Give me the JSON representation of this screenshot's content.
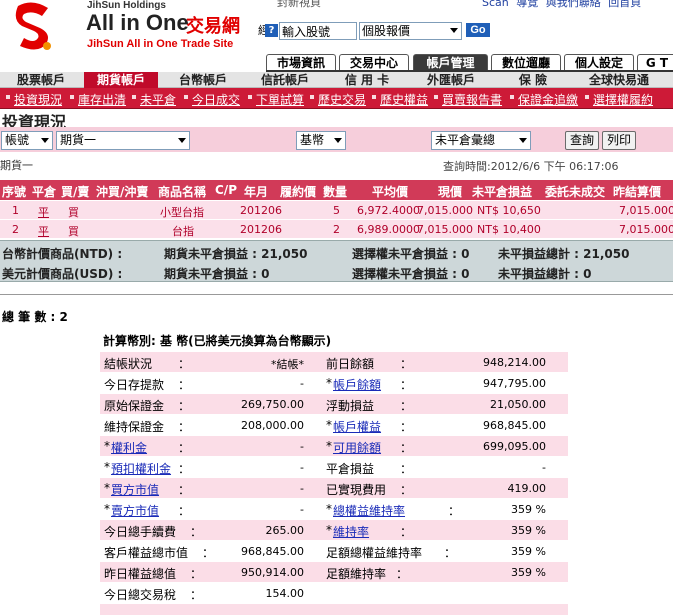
{
  "brand": {
    "holdings": "JihSun Holdings",
    "name": "All in One",
    "name_cn": "交易網",
    "subtitle": "JihSun All in One Trade Site"
  },
  "top_links": [
    "Scan",
    "導覽",
    "與我們聯絡",
    "回首頁"
  ],
  "top_strip_text": "封新視頁",
  "quote": {
    "help_icon": "?",
    "input_value": "輸入股號",
    "select_value": "個股報價",
    "go_label": "Go",
    "label_fragment": "經"
  },
  "main_tabs": [
    "市場資訊",
    "交易中心",
    "帳戶管理",
    "數位遛廳",
    "個人設定",
    "G T"
  ],
  "main_tab_active": 2,
  "account_menu": [
    "股票帳戶",
    "期貨帳戶",
    "台幣帳戶",
    "信託帳戶",
    "信 用 卡",
    "外匯帳戶",
    "保    險",
    "全球快易通"
  ],
  "account_active": 1,
  "sub_menu": [
    "投資現況",
    "庫存出清",
    "未平倉",
    "今日成交",
    "下單試算",
    "歷史交易",
    "歷史權益",
    "買賣報告書",
    "保證金追繳",
    "選擇權履約"
  ],
  "page_title": "投資現況",
  "filters": {
    "account_type": "帳號",
    "account": "期貨一",
    "currency": "基幣",
    "report": "未平倉彙總",
    "query_button": "查詢",
    "print_button": "列印"
  },
  "account_label": "期貨一",
  "query_time": "查詢時間:2012/6/6 下午 06:17:06",
  "positions": {
    "headers": [
      "序號",
      "平倉",
      "買/賣",
      "沖買/沖賣",
      "商品名稱",
      "C/P",
      "年月",
      "履約價",
      "數量",
      "平均價",
      "現價",
      "未平倉損益",
      "委託未成交",
      "昨結算價"
    ],
    "rows": [
      {
        "no": "1",
        "close": "平",
        "side": "買",
        "offset": "",
        "product": "小型台指",
        "cp": "",
        "ym": "201206",
        "strike": "",
        "qty": "5",
        "avg": "6,972.4000",
        "last": "7,015.000",
        "pnl": "NT$ 10,650",
        "pending": "",
        "settle": "7,015.000"
      },
      {
        "no": "2",
        "close": "平",
        "side": "買",
        "offset": "",
        "product": "台指",
        "cp": "",
        "ym": "201206",
        "strike": "",
        "qty": "2",
        "avg": "6,989.0000",
        "last": "7,015.000",
        "pnl": "NT$ 10,400",
        "pending": "",
        "settle": "7,015.000"
      }
    ]
  },
  "summary": {
    "ntd_label": "台幣計價商品(NTD) :",
    "usd_label": "美元計價商品(USD) :",
    "ntd_futures": "期貨未平倉損益 : 21,050",
    "ntd_options": "選擇權未平倉損益 : 0",
    "ntd_total": "未平損益總計 : 21,050",
    "usd_futures": "期貨未平倉損益 : 0",
    "usd_options": "選擇權未平倉損益 : 0",
    "usd_total": "未平損益總計 : 0"
  },
  "total_count": "總 筆 數 : 2",
  "calc_title": "計算幣別: 基 幣(已將美元換算為台幣顯示)",
  "detail": [
    {
      "l1": "結帳狀況",
      "v1": "*結帳*",
      "l2": "前日餘額",
      "v2": "948,214.00"
    },
    {
      "l1": "今日存提款",
      "v1": "-",
      "l2": "帳戶餘額",
      "v2": "947,795.00"
    },
    {
      "l1": "原始保證金",
      "v1": "269,750.00",
      "l2": "浮動損益",
      "v2": "21,050.00"
    },
    {
      "l1": "維持保證金",
      "v1": "208,000.00",
      "l2": "帳戶權益",
      "v2": "968,845.00"
    },
    {
      "l1": "權利金",
      "v1": "-",
      "l2": "可用餘額",
      "v2": "699,095.00"
    },
    {
      "l1": "預扣權利金",
      "v1": "-",
      "l2": "平倉損益",
      "v2": "-"
    },
    {
      "l1": "買方市值",
      "v1": "-",
      "l2": "已實現費用",
      "v2": "419.00"
    },
    {
      "l1": "賣方市值",
      "v1": "-",
      "l2": "總權益維持率",
      "v2": "359  %"
    },
    {
      "l1": "今日總手續費",
      "v1": "265.00",
      "l2": "維持率",
      "v2": "359  %"
    },
    {
      "l1": "客戶權益總市值",
      "v1": "968,845.00",
      "l2": "足額總權益維持率",
      "v2": "359 %"
    },
    {
      "l1": "昨日權益總值",
      "v1": "950,914.00",
      "l2": "足額維持率",
      "v2": "359 %"
    },
    {
      "l1": "今日總交易稅",
      "v1": "154.00",
      "l2": "",
      "v2": ""
    }
  ],
  "colors": {
    "brand_red": "#e10000",
    "submenu_red": "#cd1a37",
    "header_pink": "#d13a58",
    "row_pink": "#fbe0ea",
    "filter_pink": "#f6cedb",
    "summary_gray": "#cdd7d9",
    "link_blue": "#1a2bb8"
  }
}
